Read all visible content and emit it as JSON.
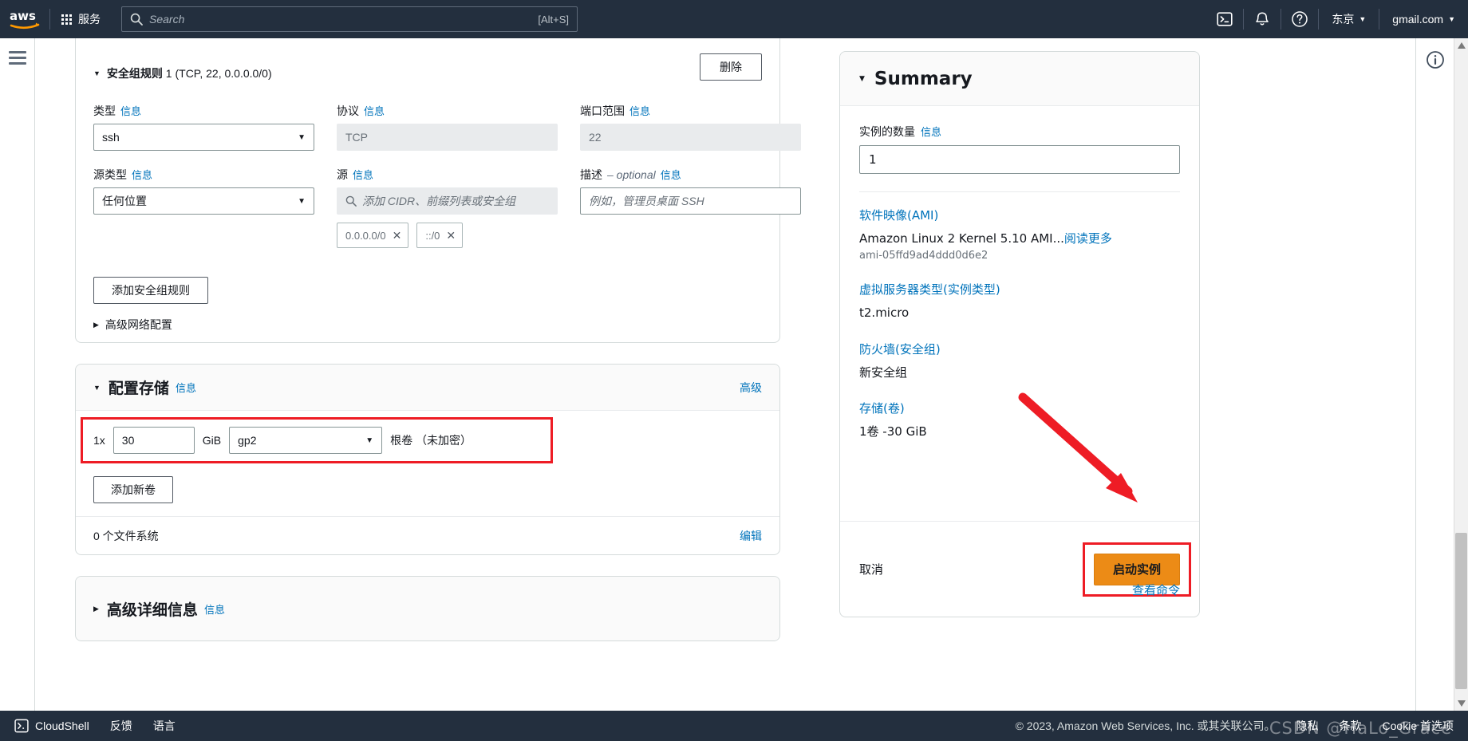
{
  "topnav": {
    "logo": "aws-logo",
    "services_label": "服务",
    "search_placeholder": "Search",
    "search_value": "",
    "search_hint": "[Alt+S]",
    "cloudshell_icon": "terminal-icon",
    "bell_icon": "bell-icon",
    "help_icon": "help-circle-icon",
    "region": "东京",
    "account": "gmail.com",
    "caret": "▼"
  },
  "security_group": {
    "rule_title_bold": "安全组规则",
    "rule_title_rest": " 1 (TCP, 22, 0.0.0.0/0)",
    "delete_label": "删除",
    "type_label": "类型",
    "type_value": "ssh",
    "protocol_label": "协议",
    "protocol_value": "TCP",
    "port_label": "端口范围",
    "port_value": "22",
    "source_type_label": "源类型",
    "source_type_value": "任何位置",
    "source_label": "源",
    "source_placeholder": "添加 CIDR、前缀列表或安全组",
    "source_tokens": [
      "0.0.0.0/0",
      "::/0"
    ],
    "desc_label": "描述",
    "desc_optional": "– optional",
    "desc_placeholder": "例如，管理员桌面 SSH",
    "desc_value": "",
    "add_rule_label": "添加安全组规则",
    "advanced_network_label": "高级网络配置",
    "info_label": "信息"
  },
  "storage": {
    "title": "配置存储",
    "info_label": "信息",
    "advanced_link": "高级",
    "volume_count": "1x",
    "volume_size": "30",
    "unit": "GiB",
    "volume_type": "gp2",
    "volume_desc": "根卷 （未加密）",
    "add_volume_label": "添加新卷",
    "filesystem_count": "0 个文件系统",
    "edit_link": "编辑"
  },
  "advanced_details": {
    "title": "高级详细信息",
    "info_label": "信息"
  },
  "summary": {
    "title": "Summary",
    "instance_count_label": "实例的数量",
    "info_label": "信息",
    "instance_count_value": "1",
    "ami_link": "软件映像(AMI)",
    "ami_name": "Amazon Linux 2 Kernel 5.10 AMI...",
    "ami_read_more": "阅读更多",
    "ami_id": "ami-05ffd9ad4ddd0d6e2",
    "instance_type_link": "虚拟服务器类型(实例类型)",
    "instance_type_value": "t2.micro",
    "firewall_link": "防火墙(安全组)",
    "firewall_value": "新安全组",
    "storage_link": "存储(卷)",
    "storage_value": "1卷 -30 GiB",
    "cancel_label": "取消",
    "launch_label": "启动实例",
    "view_command_label": "查看命令"
  },
  "footer": {
    "cloudshell_label": "CloudShell",
    "feedback_label": "反馈",
    "language_label": "语言",
    "copyright": "© 2023, Amazon Web Services, Inc. 或其关联公司。",
    "privacy_label": "隐私",
    "terms_label": "条款",
    "cookie_label": "Cookie 首选项",
    "watermark": "CSDN @HaLo_Grace"
  },
  "colors": {
    "nav_bg": "#232f3e",
    "link_blue": "#0073bb",
    "launch_orange": "#ec8b16",
    "highlight_red": "#ee1c25"
  }
}
